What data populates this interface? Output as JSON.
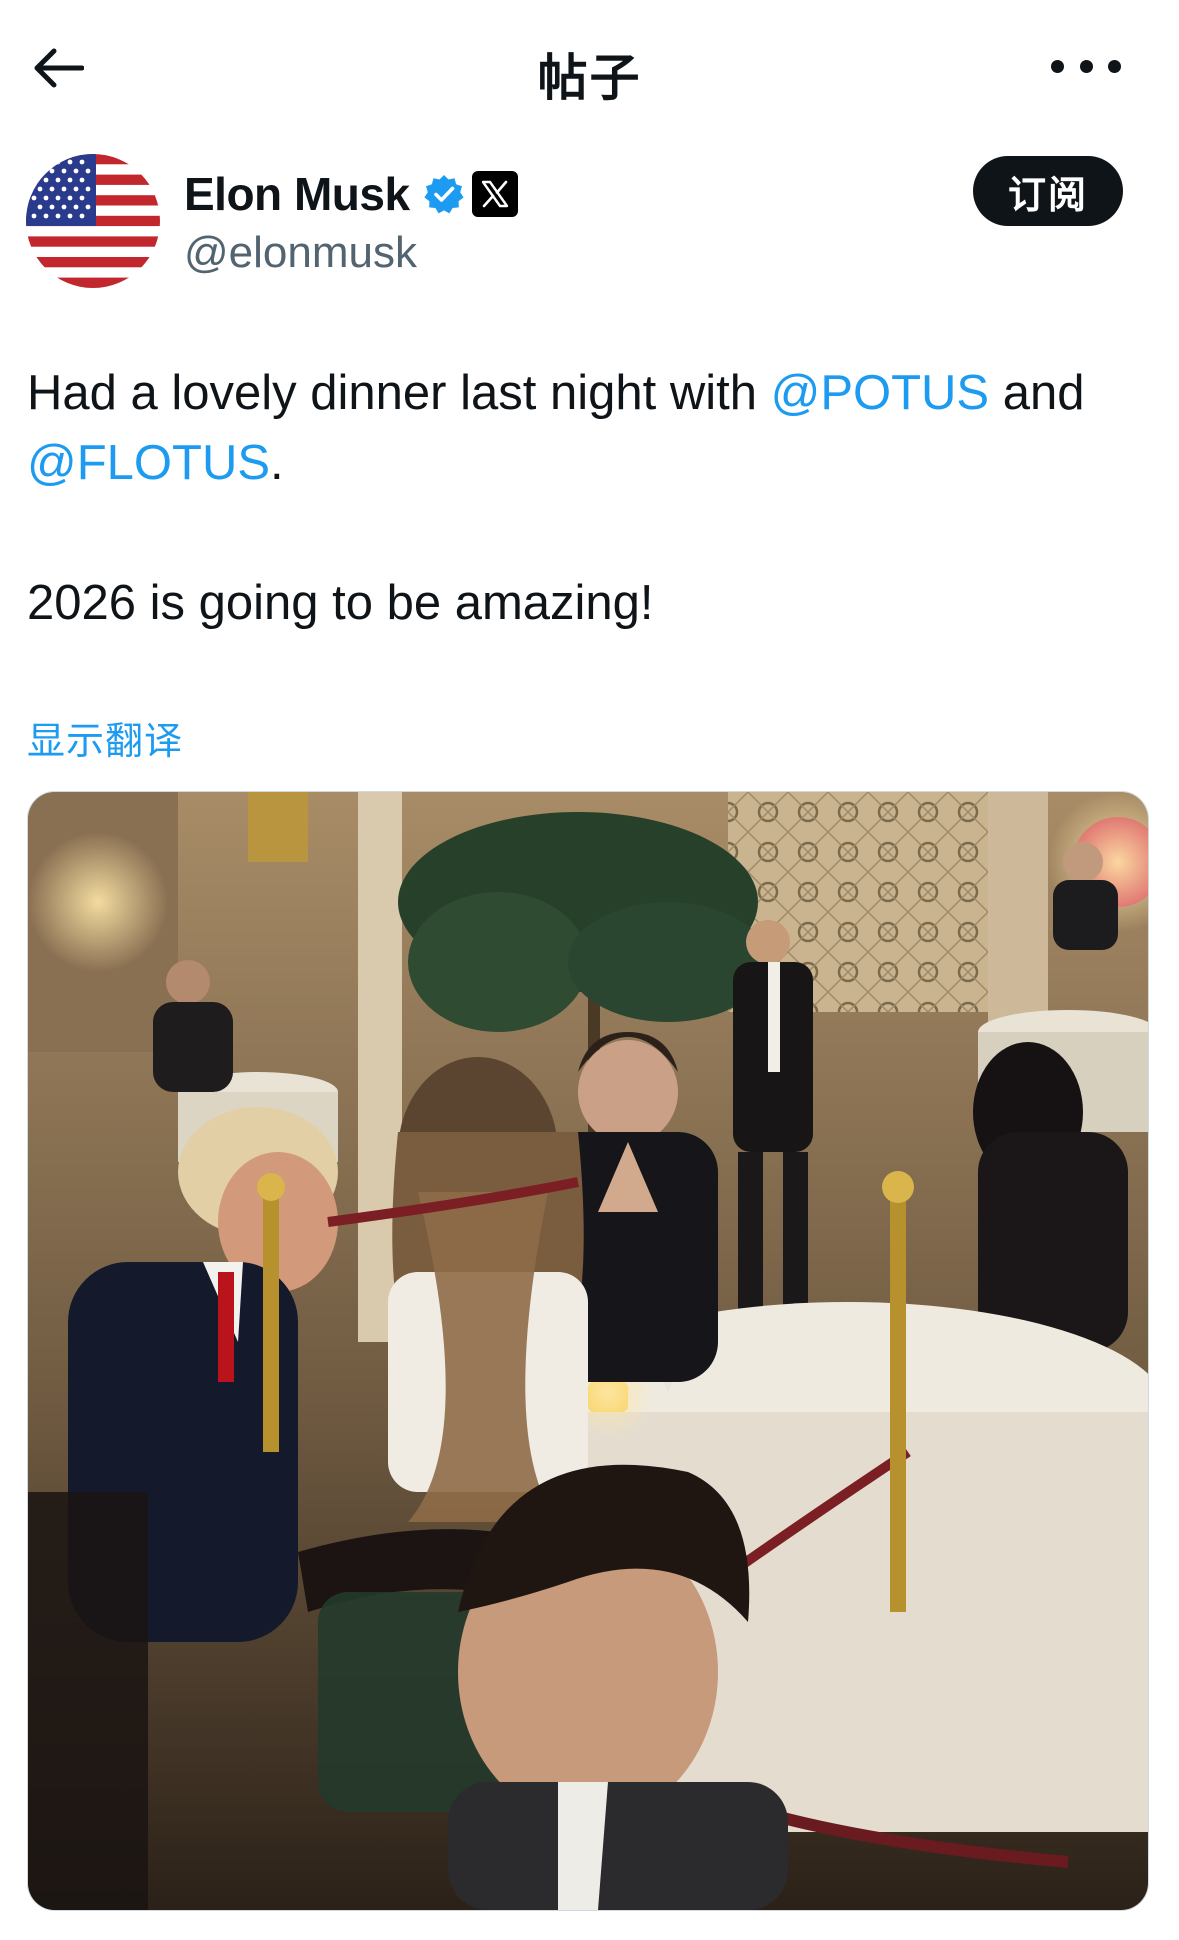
{
  "nav": {
    "title": "帖子",
    "back_icon": "arrow-left-icon",
    "more_icon": "more-horizontal-icon"
  },
  "author": {
    "display_name": "Elon Musk",
    "handle": "@elonmusk",
    "avatar": "us-flag-avatar",
    "verified_icon": "verified-badge-icon",
    "affiliate_icon": "x-logo-icon",
    "subscribe_label": "订阅"
  },
  "post": {
    "line1_text": "Had a lovely dinner last night with ",
    "mention1": "@POTUS",
    "line1_and": " and",
    "mention2": "@FLOTUS",
    "line2_end": ".",
    "line3": "2026 is going to be amazing!",
    "translate_label": "显示翻译"
  },
  "media": {
    "type": "photo",
    "subject": "dinner-photo"
  },
  "colors": {
    "text": "#0f1419",
    "secondary": "#536471",
    "link": "#1d9bf0",
    "verified": "#1d9bf0",
    "button_bg": "#0f1419"
  }
}
